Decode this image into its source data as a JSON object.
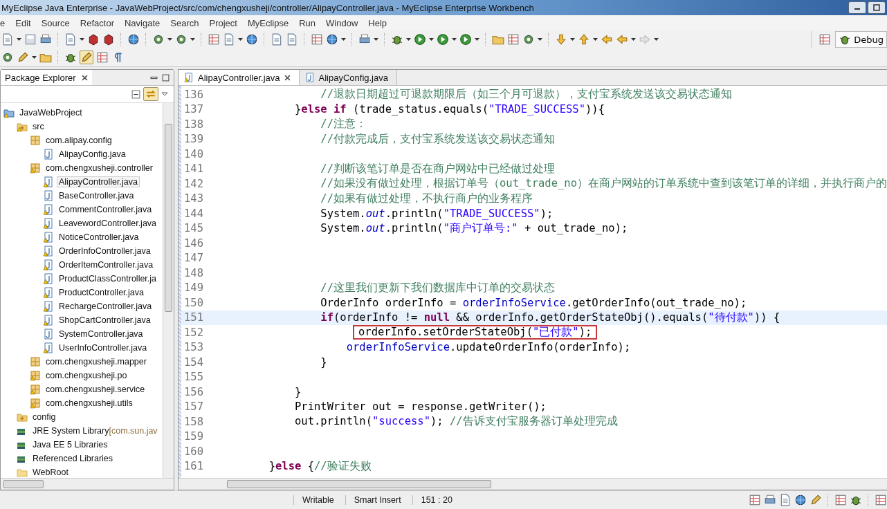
{
  "window": {
    "title": "MyEclipse Java Enterprise - JavaWebProject/src/com/chengxusheji/controller/AlipayController.java - MyEclipse Enterprise Workbench"
  },
  "menu": [
    "e",
    "Edit",
    "Source",
    "Refactor",
    "Navigate",
    "Search",
    "Project",
    "MyEclipse",
    "Run",
    "Window",
    "Help"
  ],
  "perspective": {
    "label": "Debug",
    "selected": true
  },
  "package_explorer": {
    "title": "Package Explorer",
    "tree": [
      {
        "label": "JavaWebProject",
        "kind": "project",
        "warning": true,
        "selected": false,
        "children": [
          {
            "label": "src",
            "kind": "source-folder",
            "warning": true,
            "selected": false,
            "children": [
              {
                "label": "com.alipay.config",
                "kind": "package",
                "warning": false,
                "selected": false,
                "children": [
                  {
                    "label": "AlipayConfig.java",
                    "kind": "java",
                    "warning": false,
                    "selected": false
                  }
                ]
              },
              {
                "label": "com.chengxusheji.controller",
                "kind": "package",
                "warning": true,
                "selected": false,
                "children": [
                  {
                    "label": "AlipayController.java",
                    "kind": "java",
                    "warning": true,
                    "selected": true
                  },
                  {
                    "label": "BaseController.java",
                    "kind": "java",
                    "warning": false,
                    "selected": false
                  },
                  {
                    "label": "CommentController.java",
                    "kind": "java",
                    "warning": true,
                    "selected": false
                  },
                  {
                    "label": "LeavewordController.java",
                    "kind": "java",
                    "warning": true,
                    "selected": false
                  },
                  {
                    "label": "NoticeController.java",
                    "kind": "java",
                    "warning": true,
                    "selected": false
                  },
                  {
                    "label": "OrderInfoController.java",
                    "kind": "java",
                    "warning": true,
                    "selected": false
                  },
                  {
                    "label": "OrderItemController.java",
                    "kind": "java",
                    "warning": true,
                    "selected": false
                  },
                  {
                    "label": "ProductClassController.ja",
                    "kind": "java",
                    "warning": true,
                    "selected": false
                  },
                  {
                    "label": "ProductController.java",
                    "kind": "java",
                    "warning": true,
                    "selected": false
                  },
                  {
                    "label": "RechargeController.java",
                    "kind": "java",
                    "warning": true,
                    "selected": false
                  },
                  {
                    "label": "ShopCartController.java",
                    "kind": "java",
                    "warning": true,
                    "selected": false
                  },
                  {
                    "label": "SystemController.java",
                    "kind": "java",
                    "warning": false,
                    "selected": false
                  },
                  {
                    "label": "UserInfoController.java",
                    "kind": "java",
                    "warning": true,
                    "selected": false
                  }
                ]
              },
              {
                "label": "com.chengxusheji.mapper",
                "kind": "package",
                "warning": false,
                "selected": false
              },
              {
                "label": "com.chengxusheji.po",
                "kind": "package",
                "warning": true,
                "selected": false
              },
              {
                "label": "com.chengxusheji.service",
                "kind": "package",
                "warning": true,
                "selected": false
              },
              {
                "label": "com.chengxusheji.utils",
                "kind": "package",
                "warning": true,
                "selected": false
              }
            ]
          },
          {
            "label": "config",
            "kind": "source-folder",
            "warning": false,
            "selected": false
          },
          {
            "label": "JRE System Library",
            "detail": "[com.sun.jav",
            "kind": "library",
            "warning": false,
            "selected": false
          },
          {
            "label": "Java EE 5 Libraries",
            "kind": "library",
            "warning": false,
            "selected": false
          },
          {
            "label": "Referenced Libraries",
            "kind": "library",
            "warning": false,
            "selected": false
          },
          {
            "label": "WebRoot",
            "kind": "folder",
            "warning": false,
            "selected": false
          }
        ]
      }
    ]
  },
  "editor": {
    "tabs": [
      {
        "label": "AlipayController.java",
        "selected": true,
        "warning": true
      },
      {
        "label": "AlipayConfig.java",
        "selected": false,
        "warning": false
      }
    ],
    "lines": [
      {
        "number": "136",
        "current": false,
        "tokens": [
          {
            "kind": "comment",
            "text": "                //退款日期超过可退款期限后（如三个月可退款），支付宝系统发送该交易状态通知"
          }
        ]
      },
      {
        "number": "137",
        "current": false,
        "tokens": [
          {
            "kind": "plain",
            "text": "            }"
          },
          {
            "kind": "keyword",
            "text": "else if"
          },
          {
            "kind": "plain",
            "text": " (trade_status.equals("
          },
          {
            "kind": "string",
            "text": "\"TRADE_SUCCESS\""
          },
          {
            "kind": "plain",
            "text": ")){"
          }
        ]
      },
      {
        "number": "138",
        "current": false,
        "tokens": [
          {
            "kind": "comment",
            "text": "                //注意："
          }
        ]
      },
      {
        "number": "139",
        "current": false,
        "tokens": [
          {
            "kind": "comment",
            "text": "                //付款完成后，支付宝系统发送该交易状态通知"
          }
        ]
      },
      {
        "number": "140",
        "current": false
      },
      {
        "number": "141",
        "current": false,
        "tokens": [
          {
            "kind": "comment",
            "text": "                //判断该笔订单是否在商户网站中已经做过处理"
          }
        ]
      },
      {
        "number": "142",
        "current": false,
        "tokens": [
          {
            "kind": "comment",
            "text": "                //如果没有做过处理，根据订单号（out_trade_no）在商户网站的订单系统中查到该笔订单的详细，并执行商户的"
          }
        ]
      },
      {
        "number": "143",
        "current": false,
        "tokens": [
          {
            "kind": "comment",
            "text": "                //如果有做过处理，不执行商户的业务程序"
          }
        ]
      },
      {
        "number": "144",
        "current": false,
        "tokens": [
          {
            "kind": "plain",
            "text": "                System."
          },
          {
            "kind": "static",
            "text": "out"
          },
          {
            "kind": "plain",
            "text": ".println("
          },
          {
            "kind": "string",
            "text": "\"TRADE_SUCCESS\""
          },
          {
            "kind": "plain",
            "text": ");"
          }
        ]
      },
      {
        "number": "145",
        "current": false,
        "tokens": [
          {
            "kind": "plain",
            "text": "                System."
          },
          {
            "kind": "static",
            "text": "out"
          },
          {
            "kind": "plain",
            "text": ".println("
          },
          {
            "kind": "string",
            "text": "\"商户订单号:\""
          },
          {
            "kind": "plain",
            "text": " + out_trade_no);"
          }
        ]
      },
      {
        "number": "146",
        "current": false
      },
      {
        "number": "147",
        "current": false
      },
      {
        "number": "148",
        "current": false
      },
      {
        "number": "149",
        "current": false,
        "tokens": [
          {
            "kind": "comment",
            "text": "                //这里我们更新下我们数据库中订单的交易状态"
          }
        ]
      },
      {
        "number": "150",
        "current": false,
        "tokens": [
          {
            "kind": "plain",
            "text": "                OrderInfo orderInfo = "
          },
          {
            "kind": "field",
            "text": "orderInfoService"
          },
          {
            "kind": "plain",
            "text": ".getOrderInfo(out_trade_no);"
          }
        ]
      },
      {
        "number": "151",
        "current": true,
        "tokens": [
          {
            "kind": "keyword",
            "text": "                if"
          },
          {
            "kind": "plain",
            "text": "(orderInfo != "
          },
          {
            "kind": "keyword",
            "text": "null"
          },
          {
            "kind": "plain",
            "text": " && orderInfo.getOrderStateObj().equals("
          },
          {
            "kind": "string",
            "text": "\"待付款\""
          },
          {
            "kind": "plain",
            "text": ")) {"
          }
        ]
      },
      {
        "number": "152",
        "current": false,
        "marked": true,
        "tokens": [
          {
            "kind": "plain",
            "text": "orderInfo.setOrderStateObj("
          },
          {
            "kind": "string",
            "text": "\"已付款\""
          },
          {
            "kind": "plain",
            "text": ");"
          }
        ]
      },
      {
        "number": "153",
        "current": false,
        "tokens": [
          {
            "kind": "field",
            "text": "                    orderInfoService"
          },
          {
            "kind": "plain",
            "text": ".updateOrderInfo(orderInfo);"
          }
        ]
      },
      {
        "number": "154",
        "current": false,
        "tokens": [
          {
            "kind": "plain",
            "text": "                }"
          }
        ]
      },
      {
        "number": "155",
        "current": false
      },
      {
        "number": "156",
        "current": false,
        "tokens": [
          {
            "kind": "plain",
            "text": "            }"
          }
        ]
      },
      {
        "number": "157",
        "current": false,
        "tokens": [
          {
            "kind": "plain",
            "text": "            PrintWriter out = response.getWriter();"
          }
        ]
      },
      {
        "number": "158",
        "current": false,
        "tokens": [
          {
            "kind": "plain",
            "text": "            out.println("
          },
          {
            "kind": "string",
            "text": "\"success\""
          },
          {
            "kind": "plain",
            "text": "); "
          },
          {
            "kind": "comment",
            "text": "//告诉支付宝服务器订单处理完成"
          }
        ]
      },
      {
        "number": "159",
        "current": false
      },
      {
        "number": "160",
        "current": false
      },
      {
        "number": "161",
        "current": false,
        "tokens": [
          {
            "kind": "plain",
            "text": "        }"
          },
          {
            "kind": "keyword",
            "text": "else"
          },
          {
            "kind": "plain",
            "text": " {"
          },
          {
            "kind": "comment",
            "text": "//验证失败"
          }
        ]
      }
    ]
  },
  "status_bar": {
    "mode": "Writable",
    "insert": "Smart Insert",
    "position": "151 : 20"
  }
}
